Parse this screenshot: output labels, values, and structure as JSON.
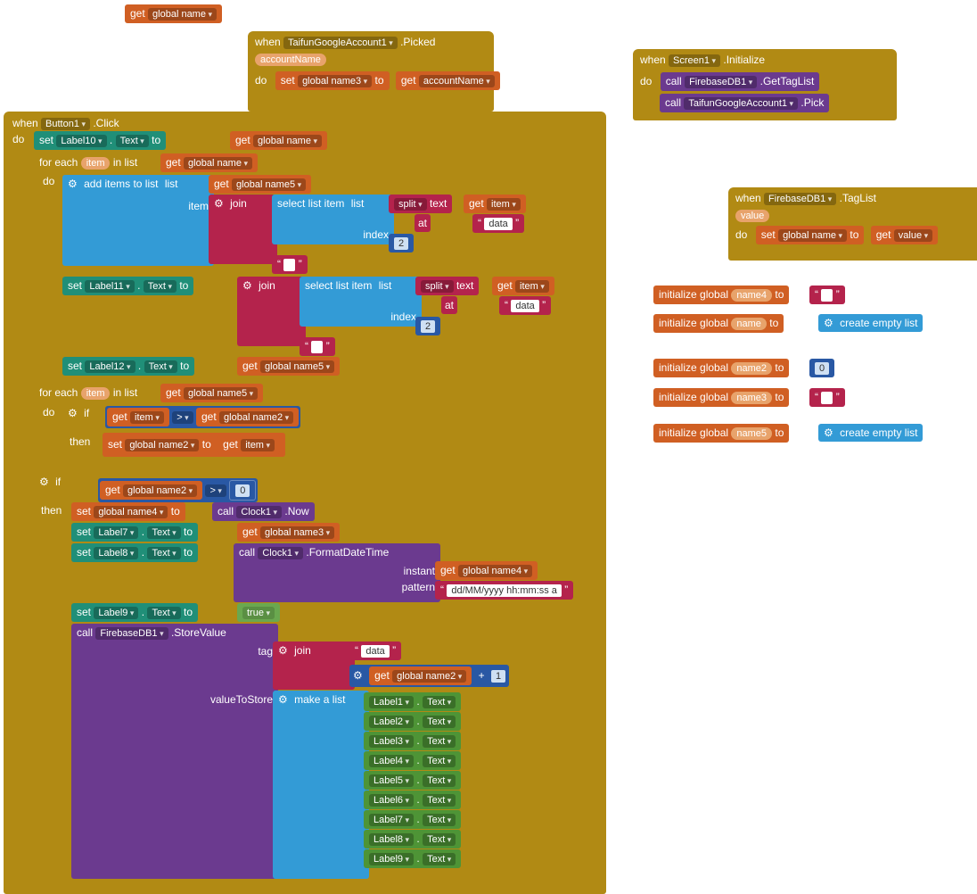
{
  "topGet": {
    "get": "get",
    "var": "global name"
  },
  "picked": {
    "when": "when",
    "comp": "TaifunGoogleAccount1",
    "event": ".Picked",
    "param": "accountName",
    "do": "do",
    "set": "set",
    "var": "global name3",
    "to": "to",
    "getLbl": "get",
    "getVar": "accountName"
  },
  "init": {
    "when": "when",
    "comp": "Screen1",
    "event": ".Initialize",
    "do": "do",
    "call1": "call",
    "c1": "FirebaseDB1",
    "m1": ".GetTagList",
    "call2": "call",
    "c2": "TaifunGoogleAccount1",
    "m2": ".Pick"
  },
  "taglist": {
    "when": "when",
    "comp": "FirebaseDB1",
    "event": ".TagList",
    "param": "value",
    "do": "do",
    "set": "set",
    "var": "global name",
    "to": "to",
    "getLbl": "get",
    "getVar": "value"
  },
  "globals": {
    "g4": {
      "init": "initialize global",
      "n": "name4",
      "to": "to",
      "v": ""
    },
    "g": {
      "init": "initialize global",
      "n": "name",
      "to": "to",
      "ce": "create empty list"
    },
    "g2": {
      "init": "initialize global",
      "n": "name2",
      "to": "to",
      "v": "0"
    },
    "g3": {
      "init": "initialize global",
      "n": "name3",
      "to": "to",
      "v": ""
    },
    "g5": {
      "init": "initialize global",
      "n": "name5",
      "to": "to",
      "ce": "create empty list"
    }
  },
  "btn": {
    "when": "when",
    "comp": "Button1",
    "event": ".Click",
    "do": "do",
    "set": "set",
    "dot": ". ",
    "Text": "Text",
    "to": "to",
    "lbl10": "Label10",
    "get": "get",
    "gname": "global name",
    "foreach": "for each",
    "item": "item",
    "inlist": "in list",
    "gname5": "global name5",
    "additems": "add items to list",
    "list": "list",
    "itemL": "item",
    "join": "join",
    "sel": "select list item",
    "listL": "list",
    "split": "split",
    "text": "text",
    "at": "at",
    "dataQ": "data",
    "idx": "index",
    "idx2": "2",
    "lbl11": "Label11",
    "lbl12": "Label12",
    "if": "if",
    "then": "then",
    "gt": ">",
    "gname2": "global name2",
    "gname3": "global name3",
    "gname4": "global name4",
    "clock": "Clock1",
    "now": ".Now",
    "fdt": ".FormatDateTime",
    "instant": "instant",
    "pattern": "pattern",
    "patternV": "dd/MM/yyyy hh:mm:ss a",
    "lbl7": "Label7",
    "lbl8": "Label8",
    "lbl9": "Label9",
    "true": "true",
    "call": "call",
    "fb": "FirebaseDB1",
    "store": ".StoreValue",
    "tag": "tag",
    "vts": "valueToStore",
    "plus": "+",
    "one": "1",
    "makeList": "make a list",
    "L1": "Label1",
    "L2": "Label2",
    "L3": "Label3",
    "L4": "Label4",
    "L5": "Label5",
    "L6": "Label6",
    "L7": "Label7",
    "L8": "Label8",
    "L9": "Label9",
    "zero": "0"
  }
}
